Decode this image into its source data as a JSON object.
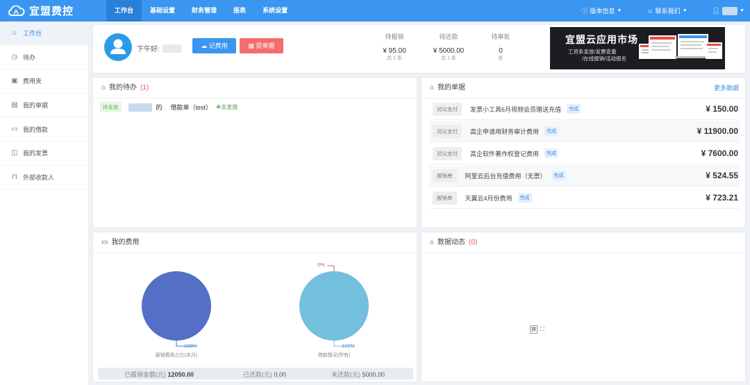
{
  "app": {
    "name": "宜盟费控"
  },
  "nav": {
    "items": [
      "工作台",
      "基础设置",
      "财务管理",
      "报表",
      "系统设置"
    ],
    "active": 0
  },
  "topright": {
    "version": "版本信息",
    "contact": "联系我们"
  },
  "sidebar": {
    "items": [
      {
        "label": "工作台",
        "icon": "home-icon"
      },
      {
        "label": "待办",
        "icon": "clock-icon"
      },
      {
        "label": "费用夹",
        "icon": "folder-icon"
      },
      {
        "label": "我的单据",
        "icon": "document-icon"
      },
      {
        "label": "我的借款",
        "icon": "wallet-icon"
      },
      {
        "label": "我的发票",
        "icon": "invoice-icon"
      },
      {
        "label": "外部收款人",
        "icon": "bookmark-icon"
      }
    ]
  },
  "welcome": {
    "greeting": "下午好:",
    "record_btn": "记费用",
    "submit_btn": "提单据"
  },
  "stats": [
    {
      "label": "待报销",
      "value": "¥ 95.00",
      "sub": "共 1 条"
    },
    {
      "label": "待还款",
      "value": "¥ 5000.00",
      "sub": "共 1 条"
    },
    {
      "label": "待审批",
      "value": "0",
      "sub": "条"
    }
  ],
  "banner": {
    "title": "宜盟云应用市场",
    "line1": "工资条发放/发票查重",
    "line2": "/在线报销/活动报名"
  },
  "todo": {
    "title": "我的待办",
    "count": "(1)",
    "item": {
      "tag": "待发放",
      "suffix": "的",
      "doc": "借款单（test）",
      "action": "去发放"
    }
  },
  "bills": {
    "title": "我的单据",
    "more": "更多数据",
    "items": [
      {
        "type": "对公支付",
        "name": "发票小工具6月视频会员赠送充值",
        "status": "完成",
        "amount": "¥ 150.00"
      },
      {
        "type": "对公支付",
        "name": "高企申请用财务审计费用",
        "status": "完成",
        "amount": "¥ 11900.00"
      },
      {
        "type": "对公支付",
        "name": "高企软件著作权登记费用",
        "status": "完成",
        "amount": "¥ 7600.00"
      },
      {
        "type": "报销单",
        "name": "阿里云后台充值费用（无票）",
        "status": "完成",
        "amount": "¥ 524.55"
      },
      {
        "type": "报销单",
        "name": "天翼云4月份费用",
        "status": "完成",
        "amount": "¥ 723.21"
      }
    ]
  },
  "expense": {
    "title": "我的费用",
    "pie1": {
      "pct_label": "100%",
      "caption": "报销费用占比(本月)",
      "color": "#5470c6"
    },
    "pie2": {
      "pct_label": "100%",
      "zero_label": "0%",
      "caption": "借款情况(所有)",
      "color": "#73c0de"
    },
    "summary": {
      "reimbursed_label": "已报销金额(元)",
      "reimbursed": "12050.00",
      "repaid_label": "已还款(元)",
      "repaid": "0.00",
      "unpaid_label": "未还款(元)",
      "unpaid": "5000.00"
    }
  },
  "activity": {
    "title": "数据动态",
    "count": "(0)"
  },
  "colors": {
    "primary": "#3a96f0",
    "danger": "#f56c6c",
    "success": "#5cb85c"
  }
}
